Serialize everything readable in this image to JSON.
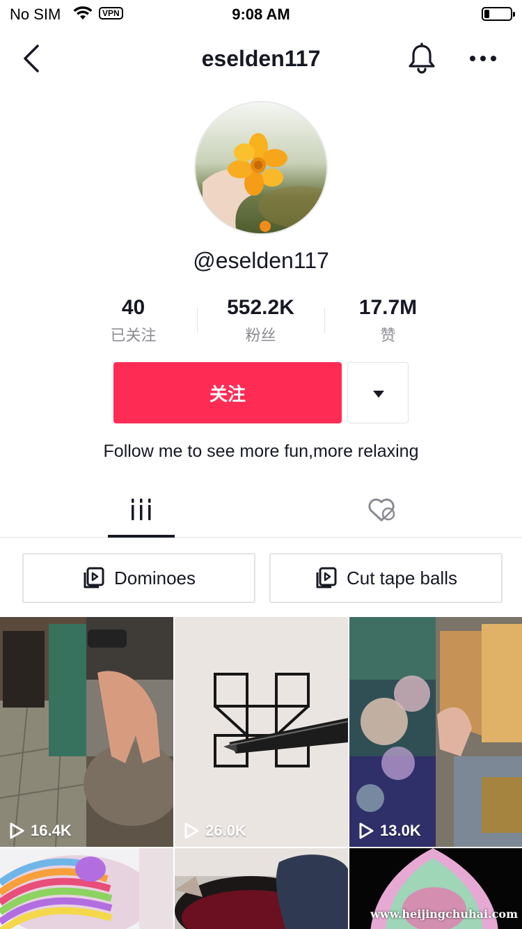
{
  "status_bar": {
    "carrier": "No SIM",
    "vpn": "VPN",
    "time": "9:08 AM",
    "battery_level": 0.2
  },
  "nav": {
    "title": "eselden117",
    "back_icon": "chevron-left-icon",
    "bell_icon": "bell-icon",
    "more_icon": "ellipsis-icon"
  },
  "profile": {
    "handle": "@eselden117",
    "bio": "Follow me to see more fun,more relaxing"
  },
  "stats": [
    {
      "value": "40",
      "label": "已关注"
    },
    {
      "value": "552.2K",
      "label": "粉丝"
    },
    {
      "value": "17.7M",
      "label": "赞"
    }
  ],
  "actions": {
    "follow_label": "关注",
    "follow_color": "#fe2c55"
  },
  "tabs": {
    "videos_icon": "grid-bars-icon",
    "liked_icon": "heart-hidden-icon"
  },
  "playlists": [
    {
      "label": "Dominoes"
    },
    {
      "label": "Cut tape balls"
    }
  ],
  "videos": [
    {
      "views": "16.4K"
    },
    {
      "views": "26.0K"
    },
    {
      "views": "13.0K"
    },
    {
      "views": ""
    },
    {
      "views": ""
    },
    {
      "views": ""
    }
  ],
  "watermark": "www.heijingchuhai.com"
}
